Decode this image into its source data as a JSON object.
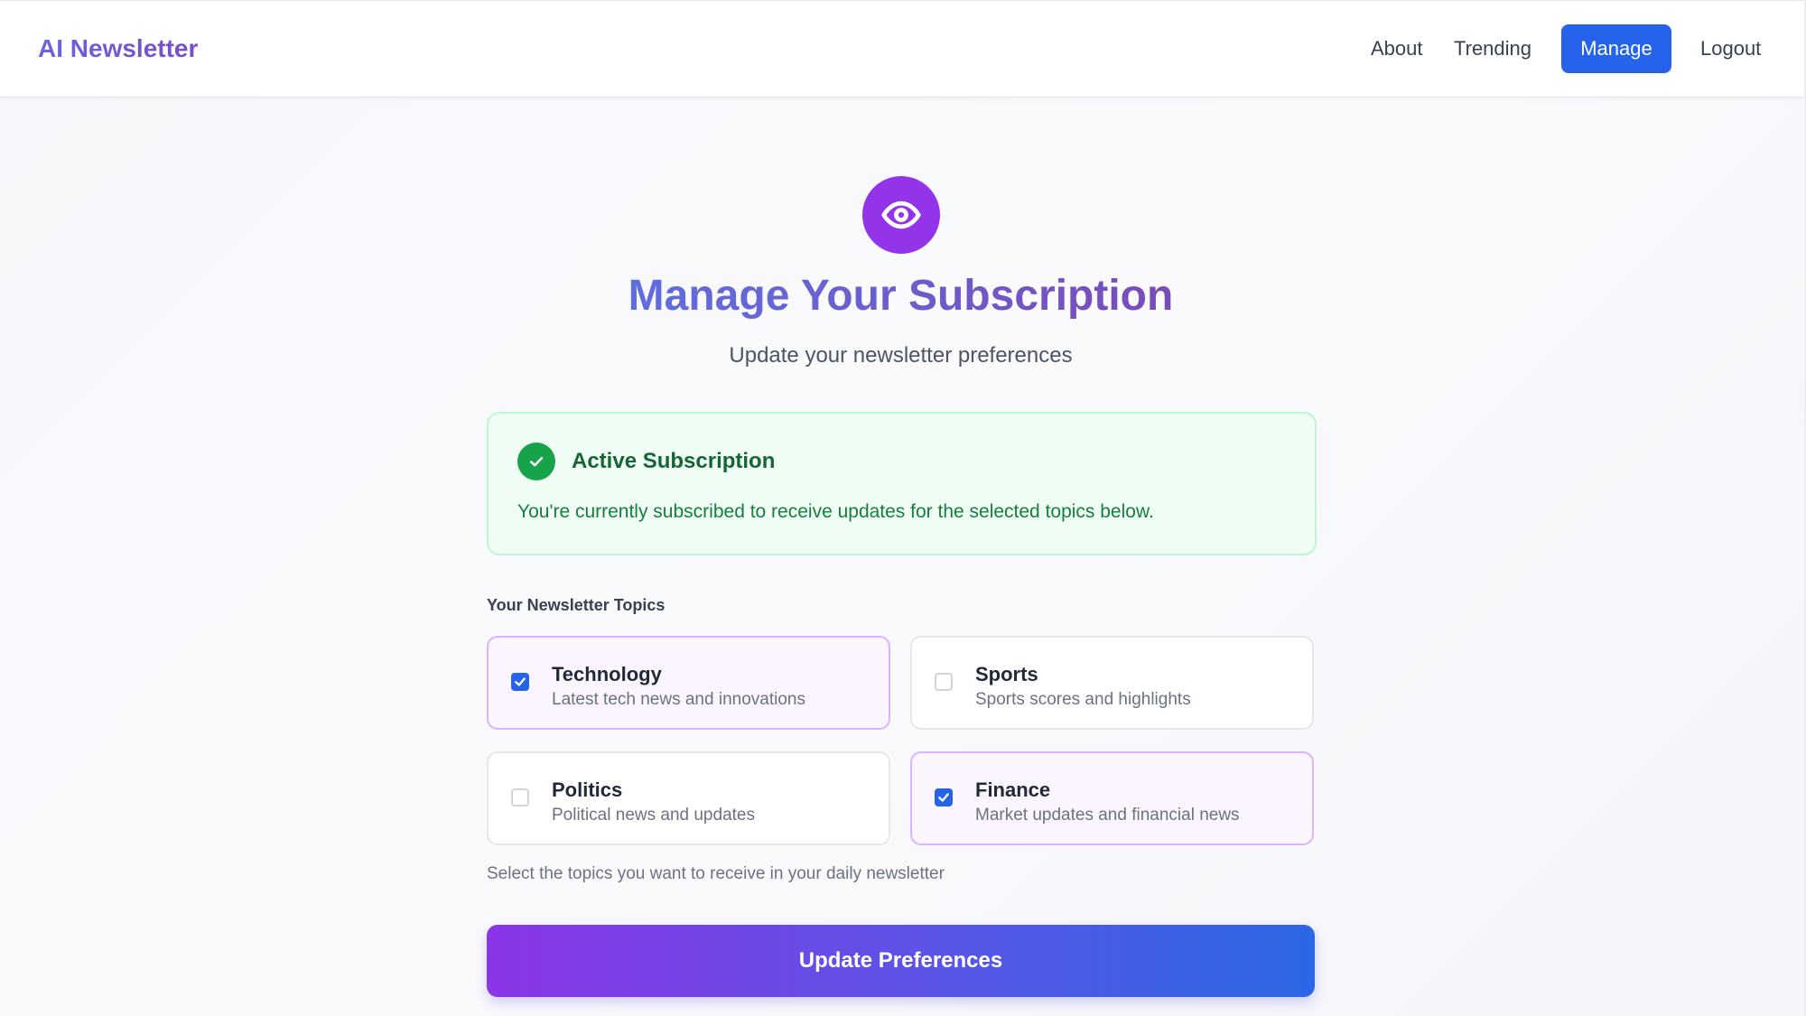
{
  "nav": {
    "brand": "AI Newsletter",
    "links": [
      "About",
      "Trending",
      "Manage",
      "Logout"
    ],
    "active": "Manage"
  },
  "hero": {
    "icon": "eye-icon",
    "title": "Manage Your Subscription",
    "subtitle": "Update your newsletter preferences"
  },
  "status": {
    "icon": "check-icon",
    "title": "Active Subscription",
    "message": "You're currently subscribed to receive updates for the selected topics below."
  },
  "topics": {
    "label": "Your Newsletter Topics",
    "items": [
      {
        "name": "Technology",
        "description": "Latest tech news and innovations",
        "checked": true
      },
      {
        "name": "Sports",
        "description": "Sports scores and highlights",
        "checked": false
      },
      {
        "name": "Politics",
        "description": "Political news and updates",
        "checked": false
      },
      {
        "name": "Finance",
        "description": "Market updates and financial news",
        "checked": true
      }
    ],
    "helper": "Select the topics you want to receive in your daily newsletter"
  },
  "form": {
    "submit_label": "Update Preferences"
  },
  "colors": {
    "primary": "#2563eb",
    "accent_purple": "#9333ea",
    "success": "#16a34a",
    "selected_border": "#d8b4fe"
  }
}
